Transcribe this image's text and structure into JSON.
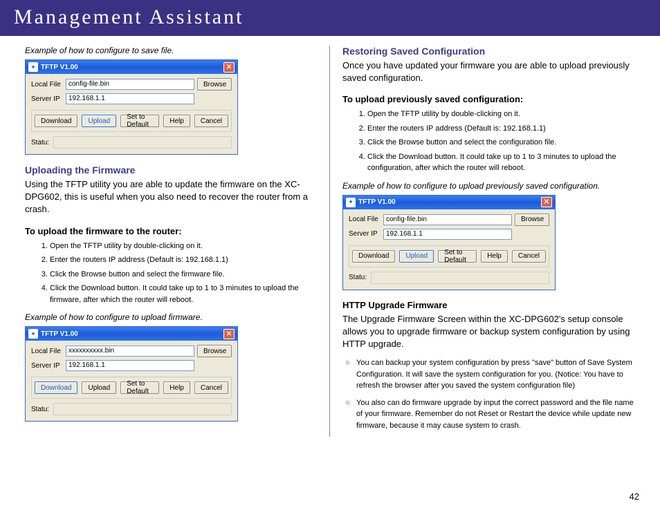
{
  "header": {
    "title": "Management Assistant"
  },
  "page_number": "42",
  "left": {
    "caption1": "Example of how to configure to save file.",
    "uploading": {
      "heading": "Uploading the Firmware",
      "body": "Using the TFTP utility you are able to update the firmware on the XC-DPG602, this is useful when you also need to recover the router from a crash.",
      "sub": "To upload the firmware to the router:",
      "steps": [
        "Open the TFTP utility by double-clicking on it.",
        "Enter the routers IP address (Default is: 192.168.1.1)",
        "Click the Browse button and select the firmware file.",
        "Click the Download button. It could take up to 1 to 3 minutes to upload the firmware, after which the router will reboot."
      ]
    },
    "caption2": "Example of how to configure to upload firmware."
  },
  "right": {
    "restoring": {
      "heading": "Restoring Saved Configuration",
      "body": "Once you have updated your firmware you are able to upload previously saved configuration.",
      "sub": "To upload previously saved configuration:",
      "steps": [
        "Open the TFTP utility by double-clicking on it.",
        "Enter the routers IP address (Default is: 192.168.1.1)",
        "Click the Browse button and select the configuration file.",
        "Click the Download button. It could take up to 1 to 3 minutes to upload the configuration, after which the router will reboot."
      ]
    },
    "caption3": "Example of how to configure to upload previously saved configuration.",
    "http": {
      "heading": "HTTP Upgrade Firmware",
      "body": "The Upgrade Firmware Screen within the XC-DPG602's setup console allows you to upgrade firmware or backup system configuration by using HTTP upgrade.",
      "bullets": [
        "You can backup your system configuration by press \"save\" button of Save System Configuration. It will save the system configuration for you. (Notice: You have to refresh the browser after you saved the system configuration file)",
        "You also can do firmware upgrade by input the correct password and the file name of your firmware. Remember do not Reset or Restart the device while update new firmware, because  it may cause system to crash."
      ]
    }
  },
  "tftp": {
    "title": "TFTP V1.00",
    "local_file_label": "Local File",
    "server_ip_label": "Server IP",
    "server_ip": "192.168.1.1",
    "config_file": "config-file.bin",
    "firmware_file": "xxxxxxxxxx.bin",
    "browse": "Browse",
    "download": "Download",
    "upload": "Upload",
    "set_default": "Set to Default",
    "help": "Help",
    "cancel": "Cancel",
    "status": "Statu:"
  }
}
